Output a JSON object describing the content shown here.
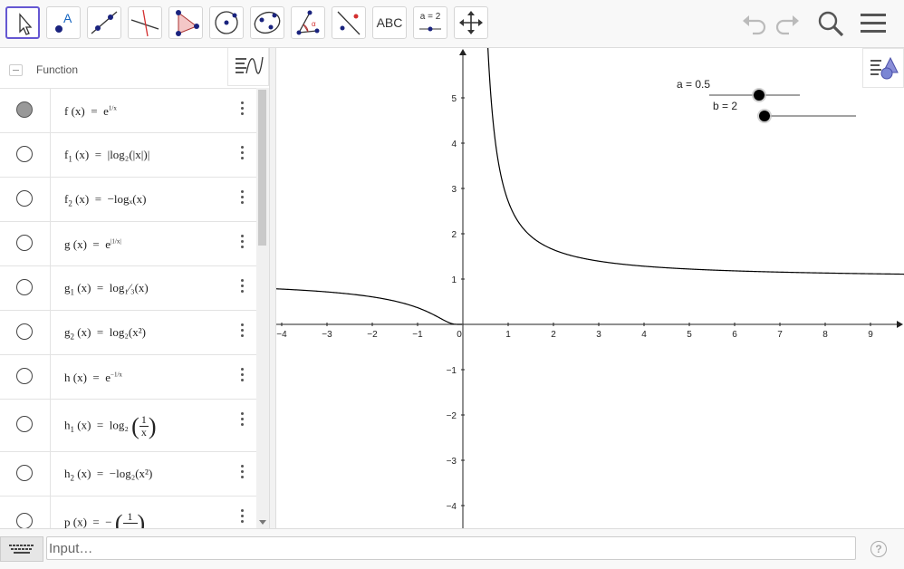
{
  "toolbar": {
    "tools": [
      {
        "name": "move-tool",
        "icon": "cursor-arrow-icon",
        "active": true
      },
      {
        "name": "point-tool",
        "icon": "point-icon"
      },
      {
        "name": "line-tool",
        "icon": "line-icon"
      },
      {
        "name": "perpendicular-tool",
        "icon": "perpendicular-line-icon"
      },
      {
        "name": "polygon-tool",
        "icon": "polygon-icon"
      },
      {
        "name": "circle-tool",
        "icon": "circle-center-icon"
      },
      {
        "name": "conic-tool",
        "icon": "ellipse-icon"
      },
      {
        "name": "angle-tool",
        "icon": "angle-icon"
      },
      {
        "name": "reflect-tool",
        "icon": "reflect-icon"
      },
      {
        "name": "text-tool",
        "label": "ABC"
      },
      {
        "name": "slider-tool",
        "label": "a = 2"
      },
      {
        "name": "move-graphics-tool",
        "icon": "move-arrows-icon"
      }
    ],
    "undo": "undo-icon",
    "redo": "redo-icon",
    "search": "search-icon",
    "menu": "menu-icon"
  },
  "algebra": {
    "header": "Function",
    "rows": [
      {
        "label": "f",
        "sub": "",
        "expr": "e",
        "visible": true,
        "kind": "exp-frac",
        "sup": "1/x"
      },
      {
        "label": "f",
        "sub": "1",
        "expr": "|log₂(|x|)|",
        "visible": false,
        "kind": "plain"
      },
      {
        "label": "f",
        "sub": "2",
        "expr": "−logₓ(x)",
        "visible": false,
        "kind": "plain"
      },
      {
        "label": "g",
        "sub": "",
        "expr": "e",
        "visible": false,
        "kind": "exp-frac",
        "sup": "|1/x|"
      },
      {
        "label": "g",
        "sub": "1",
        "expr": "log₁⁄₃(x)",
        "visible": false,
        "kind": "plain"
      },
      {
        "label": "g",
        "sub": "2",
        "expr": "log₂(x²)",
        "visible": false,
        "kind": "plain"
      },
      {
        "label": "h",
        "sub": "",
        "expr": "e",
        "visible": false,
        "kind": "exp-frac",
        "sup": "−1/x"
      },
      {
        "label": "h",
        "sub": "1",
        "expr": "log₂",
        "visible": false,
        "kind": "big-frac",
        "frac": [
          "1",
          "x"
        ]
      },
      {
        "label": "h",
        "sub": "2",
        "expr": "−log₂(x²)",
        "visible": false,
        "kind": "plain"
      },
      {
        "label": "p",
        "sub": "",
        "expr": "−",
        "visible": false,
        "kind": "big-frac",
        "frac": [
          "1",
          ""
        ]
      }
    ]
  },
  "graphics": {
    "x_ticks": [
      "−4",
      "−3",
      "−2",
      "−1",
      "0",
      "1",
      "2",
      "3",
      "4",
      "5",
      "6",
      "7",
      "8",
      "9"
    ],
    "y_ticks": [
      "5",
      "4",
      "3",
      "2",
      "1",
      "−1",
      "−2",
      "−3",
      "−4"
    ],
    "sliders": [
      {
        "label": "a = 0.5",
        "value": 0.5
      },
      {
        "label": "b = 2",
        "value": 2
      }
    ],
    "curve_color": "#000000"
  },
  "input": {
    "placeholder": "Input…"
  },
  "help_label": "?"
}
